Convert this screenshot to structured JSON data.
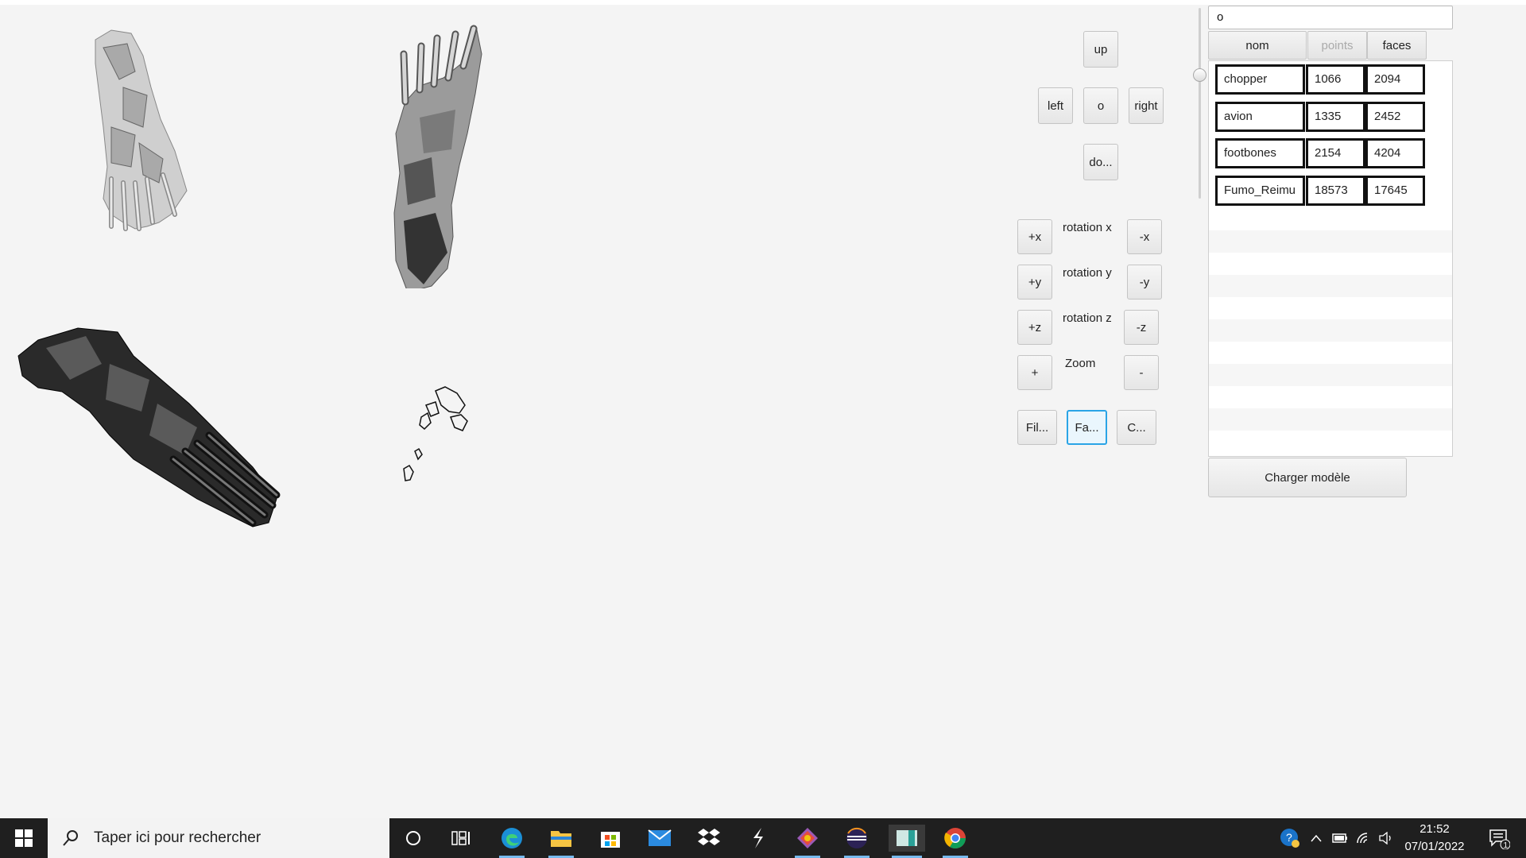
{
  "nav": {
    "up": "up",
    "left": "left",
    "center": "o",
    "right": "right",
    "down": "do..."
  },
  "rotation": {
    "plus_x": "+x",
    "label_x": "rotation x",
    "minus_x": "-x",
    "plus_y": "+y",
    "label_y": "rotation y",
    "minus_y": "-y",
    "plus_z": "+z",
    "label_z": "rotation z",
    "minus_z": "-z",
    "zoom_plus": "+",
    "zoom_label": "Zoom",
    "zoom_minus": "-"
  },
  "render_modes": {
    "fil": "Fil...",
    "fa": "Fa...",
    "c": "C..."
  },
  "search": {
    "value": "o"
  },
  "table": {
    "headers": {
      "nom": "nom",
      "points": "points",
      "faces": "faces"
    },
    "rows": [
      {
        "nom": "chopper",
        "points": "1066",
        "faces": "2094"
      },
      {
        "nom": "avion",
        "points": "1335",
        "faces": "2452"
      },
      {
        "nom": "footbones",
        "points": "2154",
        "faces": "4204"
      },
      {
        "nom": "Fumo_Reimu",
        "points": "18573",
        "faces": "17645"
      }
    ]
  },
  "load_button": "Charger modèle",
  "taskbar": {
    "search_placeholder": "Taper ici pour rechercher",
    "time": "21:52",
    "date": "07/01/2022",
    "notification_count": "1",
    "icons": [
      "start-icon",
      "cortana-icon",
      "task-view-icon",
      "edge-icon",
      "file-explorer-icon",
      "store-icon",
      "mail-icon",
      "dropbox-icon",
      "app-s-icon",
      "gitkraken-icon",
      "eclipse-icon",
      "java-app-icon",
      "chrome-icon"
    ]
  }
}
